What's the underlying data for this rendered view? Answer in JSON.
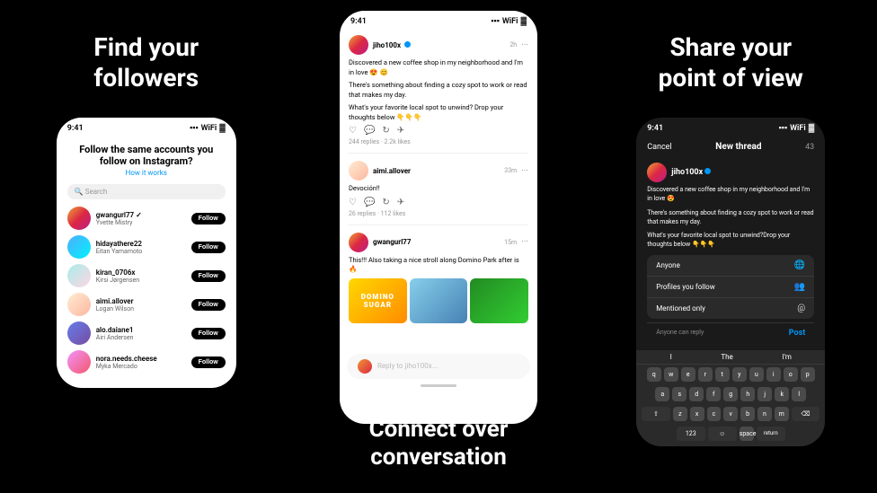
{
  "left": {
    "headline_line1": "Find your",
    "headline_line2": "followers",
    "phone": {
      "status_time": "9:41",
      "title": "Follow the same accounts you",
      "title2": "follow on Instagram?",
      "how_it_works": "How it works",
      "search_placeholder": "Search",
      "users": [
        {
          "name": "gwangurl77 ✓",
          "sub": "Yvette Mistry",
          "btn": "Follow",
          "avatar": "avatar-1"
        },
        {
          "name": "hidayathere22",
          "sub": "Eitan Yamamoto",
          "btn": "Follow",
          "avatar": "avatar-2"
        },
        {
          "name": "kiran_0706x",
          "sub": "Kirsi Jørgensen",
          "btn": "Follow",
          "avatar": "avatar-3"
        },
        {
          "name": "aimi.allover",
          "sub": "Logan Wilson",
          "btn": "Follow",
          "avatar": "avatar-4"
        },
        {
          "name": "alo.daiane1",
          "sub": "Airi Andersen",
          "btn": "Follow",
          "avatar": "avatar-5"
        },
        {
          "name": "nora.needs.cheese",
          "sub": "Myka Mercado",
          "btn": "Follow",
          "avatar": "avatar-6"
        }
      ]
    }
  },
  "middle": {
    "posts": [
      {
        "user": "jiho100x",
        "verified": true,
        "time": "2h",
        "text": "Discovered a new coffee shop in my neighborhood and I'm in love 😍",
        "text2": "There's something about finding a cozy spot to work or read that makes my day.",
        "text3": "What's your favorite local spot to unwind? Drop your thoughts below 👇👇👇",
        "replies": "244 replies",
        "likes": "2.2k likes"
      },
      {
        "user": "aimi.allover",
        "verified": false,
        "time": "33m",
        "text": "Devoción!!",
        "replies": "26 replies",
        "likes": "112 likes"
      },
      {
        "user": "gwangurl77",
        "verified": false,
        "time": "15m",
        "text": "This!!! Also taking a nice stroll along Domino Park after is 🔥",
        "has_images": true
      }
    ],
    "reply_placeholder": "Reply to jiho100x...",
    "footer_line1": "Connect over",
    "footer_line2": "conversation"
  },
  "right": {
    "headline_line1": "Share your",
    "headline_line2": "point of view",
    "phone": {
      "status_time": "9:41",
      "cancel": "Cancel",
      "title": "New thread",
      "char_count": "43",
      "user": "jiho100x",
      "verified": true,
      "compose_text1": "Discovered a new coffee shop in my neighborhood and I'm in love 😍",
      "compose_text2": "There's something about finding a cozy spot to work or read that makes my day.",
      "compose_text3": "What's your favorite local spot to unwind?Drop your thoughts below 👇👇👇",
      "reply_options": [
        {
          "label": "Anyone",
          "icon": "🌐"
        },
        {
          "label": "Profiles you follow",
          "icon": "👥"
        },
        {
          "label": "Mentioned only",
          "icon": "@"
        }
      ],
      "anyone_can_reply": "Anyone can reply",
      "post_btn": "Post",
      "keyboard_rows": [
        [
          "q",
          "w",
          "e",
          "r",
          "t",
          "y",
          "u",
          "i",
          "o",
          "p"
        ],
        [
          "a",
          "s",
          "d",
          "f",
          "g",
          "h",
          "j",
          "k",
          "l"
        ],
        [
          "⇧",
          "z",
          "x",
          "c",
          "v",
          "b",
          "n",
          "m",
          "⌫"
        ]
      ],
      "quick_words": [
        "I",
        "The",
        "I'm"
      ]
    }
  }
}
